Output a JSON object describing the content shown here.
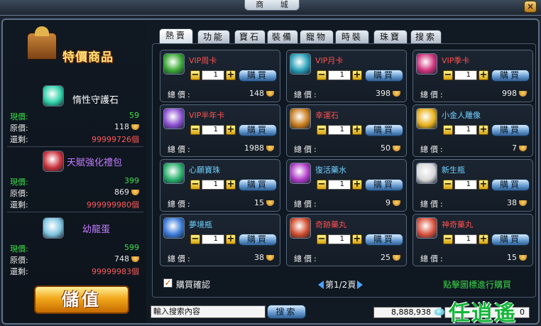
{
  "window": {
    "title": "商    城",
    "close_label": "×"
  },
  "left": {
    "special_title": "特價商品",
    "items": [
      {
        "name": "惰性守護石",
        "now_label": "現價:",
        "now": "59",
        "orig_label": "原價:",
        "orig": "118",
        "left_label": "還剩:",
        "left": "99999726個",
        "name_color": "#ffffff"
      },
      {
        "name": "天賦強化禮包",
        "now_label": "現價:",
        "now": "399",
        "orig_label": "原價:",
        "orig": "869",
        "left_label": "還剩:",
        "left": "999999980個",
        "name_color": "#c27bff"
      },
      {
        "name": "幼龍蛋",
        "now_label": "現價:",
        "now": "599",
        "orig_label": "原價:",
        "orig": "748",
        "left_label": "還剩:",
        "left": "99999983個",
        "name_color": "#c27bff"
      }
    ],
    "recharge_label": "儲值"
  },
  "tabs": [
    "熱賣",
    "功能",
    "寶石",
    "裝備",
    "寵物",
    "時裝",
    "珠寶",
    "搜索"
  ],
  "cards": [
    {
      "name": "VIP周卡",
      "qty": "1",
      "buy": "購買",
      "total_label": "總價:",
      "total": "148",
      "name_color": "#ff4f4f",
      "icon_color": "#3aa832"
    },
    {
      "name": "VIP月卡",
      "qty": "1",
      "buy": "購買",
      "total_label": "總價:",
      "total": "398",
      "name_color": "#ff4f4f",
      "icon_color": "#27a0b8"
    },
    {
      "name": "VIP季卡",
      "qty": "1",
      "buy": "購買",
      "total_label": "總價:",
      "total": "998",
      "name_color": "#ff4f4f",
      "icon_color": "#d0307a"
    },
    {
      "name": "VIP半年卡",
      "qty": "1",
      "buy": "購買",
      "total_label": "總價:",
      "total": "1988",
      "name_color": "#ff4f4f",
      "icon_color": "#8a4fd0"
    },
    {
      "name": "幸運石",
      "qty": "1",
      "buy": "購買",
      "total_label": "總價:",
      "total": "50",
      "name_color": "#ff4f4f",
      "icon_color": "#c97a1a"
    },
    {
      "name": "小金人雕像",
      "qty": "1",
      "buy": "購買",
      "total_label": "總價:",
      "total": "7",
      "name_color": "#6fd0ff",
      "icon_color": "#e8b01a"
    },
    {
      "name": "心願寶珠",
      "qty": "1",
      "buy": "購買",
      "total_label": "總價:",
      "total": "15",
      "name_color": "#6fd0ff",
      "icon_color": "#28b06a"
    },
    {
      "name": "復活藥水",
      "qty": "1",
      "buy": "購買",
      "total_label": "總價:",
      "total": "9",
      "name_color": "#6fd0ff",
      "icon_color": "#b03ac8"
    },
    {
      "name": "新生瓶",
      "qty": "1",
      "buy": "購買",
      "total_label": "總價:",
      "total": "38",
      "name_color": "#6fd0ff",
      "icon_color": "#d8d8d8"
    },
    {
      "name": "夢境瓶",
      "qty": "1",
      "buy": "購買",
      "total_label": "總價:",
      "total": "38",
      "name_color": "#6fd0ff",
      "icon_color": "#3a7ad8"
    },
    {
      "name": "奇跡藥丸",
      "qty": "1",
      "buy": "購買",
      "total_label": "總價:",
      "total": "25",
      "name_color": "#ff4f4f",
      "icon_color": "#d04a2a"
    },
    {
      "name": "神奇藥丸",
      "qty": "1",
      "buy": "購買",
      "total_label": "總價:",
      "total": "15",
      "name_color": "#ff4f4f",
      "icon_color": "#d8503a"
    }
  ],
  "bottom": {
    "confirm_label": "購買確認",
    "page_label": "第1/2頁",
    "hint": "點擊圖標進行購買",
    "search_placeholder": "輸入搜索內容",
    "search_button": "搜索",
    "balance": "8,888,938",
    "balance2": "0"
  },
  "watermark": "任逍遙"
}
